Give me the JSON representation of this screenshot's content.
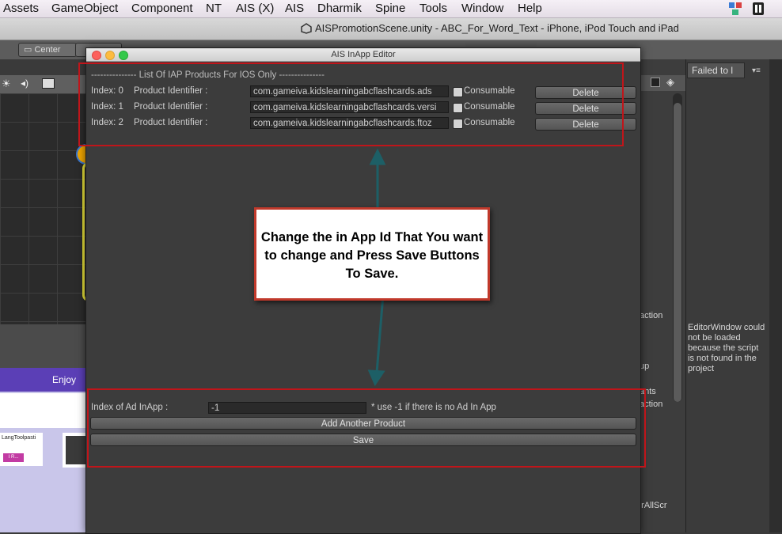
{
  "menubar": {
    "items": [
      "Assets",
      "GameObject",
      "Component",
      "NT",
      "AIS (X)",
      "AIS",
      "Dharmik",
      "Spine",
      "Tools",
      "Window",
      "Help"
    ]
  },
  "unity": {
    "window_title": "AISPromotionScene.unity - ABC_For_Word_Text - iPhone, iPod Touch and iPad",
    "center_button": "Center",
    "game_banner": "Enjoy Mo",
    "game_tile_label": "LangToolpasti",
    "game_tile_button": "I R..."
  },
  "console": {
    "tab": "Failed to l",
    "message": "EditorWindow could not be loaded because the script is not found in the project"
  },
  "side_labels": [
    "action",
    "up",
    "ants",
    "action",
    "orAllScr"
  ],
  "editor": {
    "title": "AIS InApp Editor",
    "list_header": "--------------- List Of IAP Products For IOS Only ---------------",
    "products": [
      {
        "index": "Index: 0",
        "label": "Product Identifier :",
        "value": "com.gameiva.kidslearningabcflashcards.ads",
        "consumable": "Consumable",
        "delete": "Delete"
      },
      {
        "index": "Index: 1",
        "label": "Product Identifier :",
        "value": "com.gameiva.kidslearningabcflashcards.versi",
        "consumable": "Consumable",
        "delete": "Delete"
      },
      {
        "index": "Index: 2",
        "label": "Product Identifier :",
        "value": "com.gameiva.kidslearningabcflashcards.ftoz",
        "consumable": "Consumable",
        "delete": "Delete"
      }
    ],
    "ad_index_label": "Index of Ad InApp :",
    "ad_index_value": "-1",
    "ad_hint": "* use -1 if there is no Ad In App",
    "add_button": "Add Another Product",
    "save_button": "Save"
  },
  "callout": {
    "text": "Change the in App Id That You want to change and Press Save Buttons To Save."
  },
  "colors": {
    "annotation_red": "#c0151a",
    "arrow_teal": "#1d5f66"
  }
}
